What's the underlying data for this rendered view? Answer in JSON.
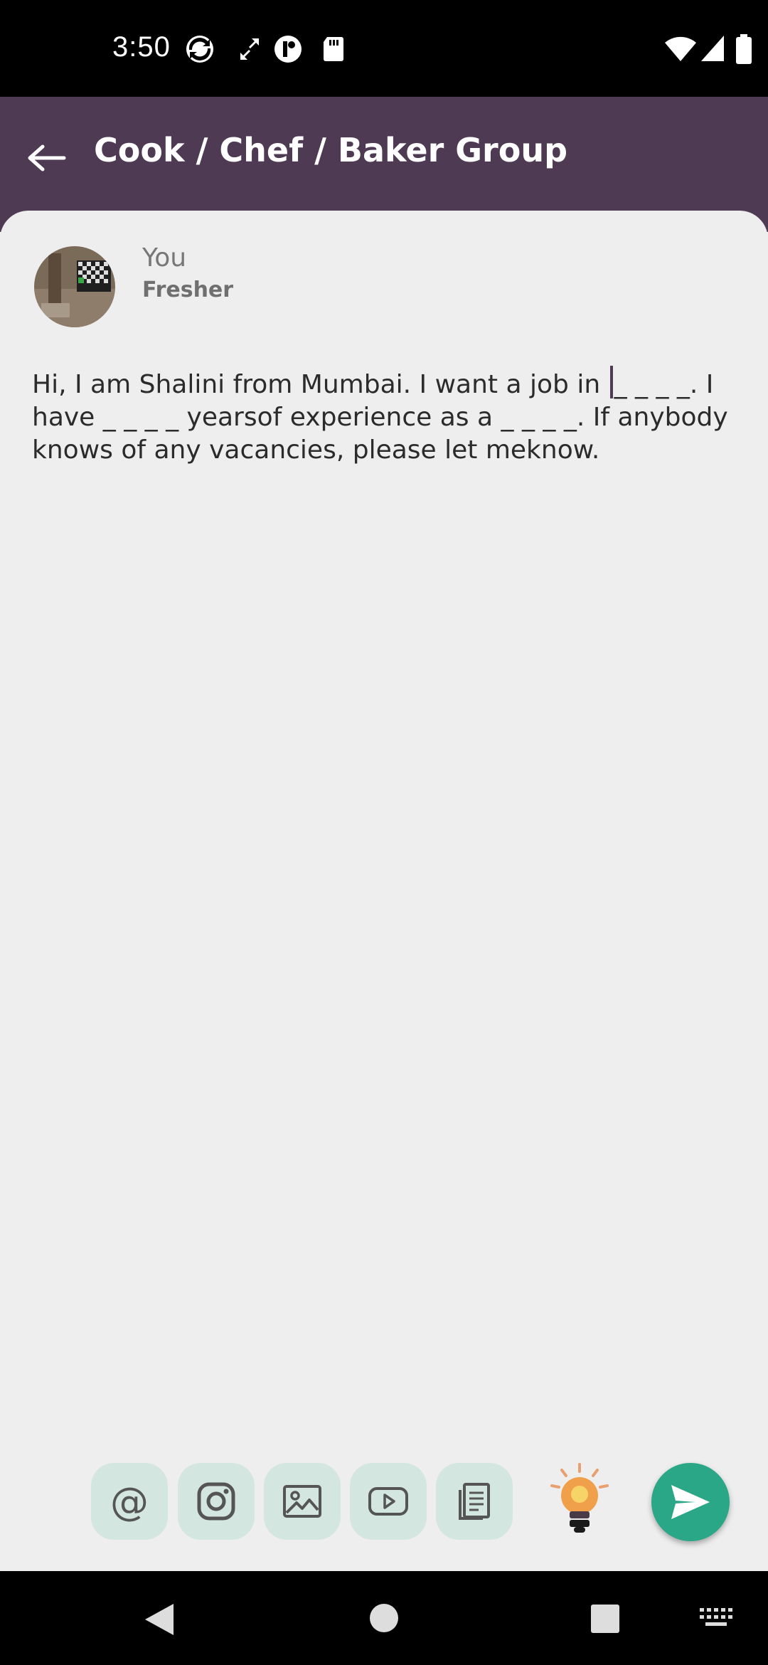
{
  "status_bar": {
    "time": "3:50"
  },
  "header": {
    "title": "Cook / Chef / Baker Group",
    "back_icon": "arrow-left-icon"
  },
  "post": {
    "author": "You",
    "subtitle": "Fresher",
    "message_part1": "Hi, I am Shalini from Mumbai. I want a job in ",
    "message_part2": "_ _ _ _. I have _ _ _ _ yearsof experience as a _ _ _ _. If anybody knows of any vacancies, please let meknow."
  },
  "toolbar": {
    "mention_label": "@",
    "items": [
      "mention-icon",
      "instagram-icon",
      "image-icon",
      "youtube-icon",
      "document-icon",
      "lightbulb-icon",
      "send-icon"
    ]
  },
  "colors": {
    "header_bg": "#4f3a53",
    "tool_bg": "#d4e6e0",
    "send_bg": "#2aa786",
    "page_bg": "#eeeeee"
  }
}
